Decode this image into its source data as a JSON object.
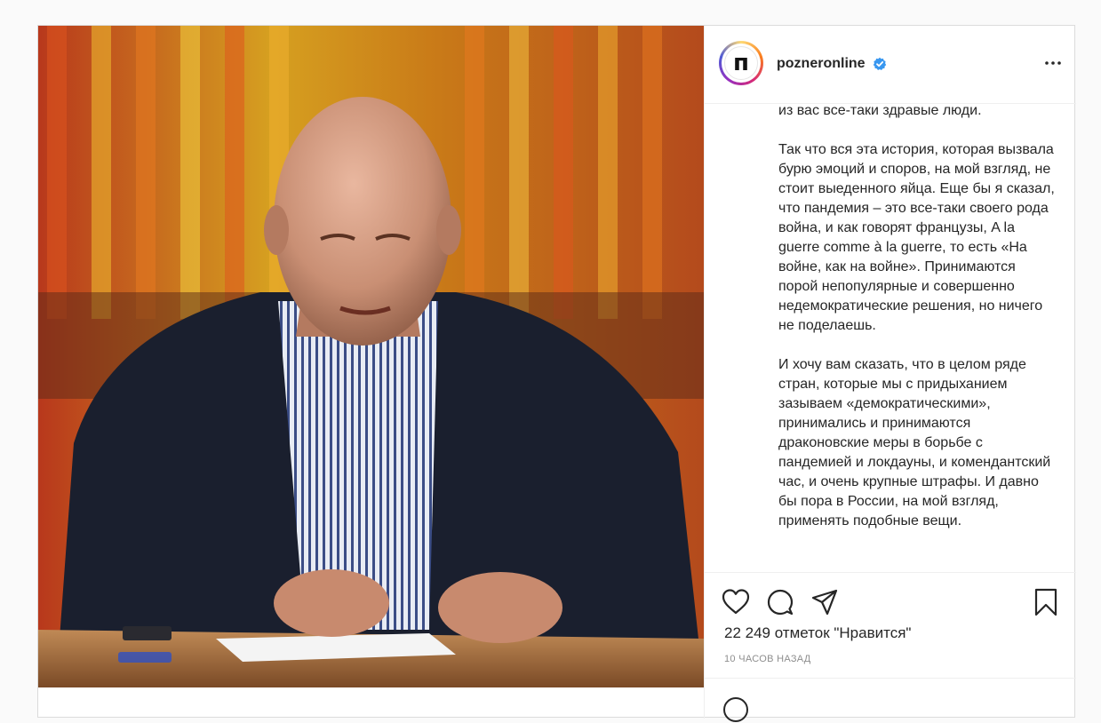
{
  "post": {
    "username": "pozneronline",
    "avatar_letter": "п",
    "caption_paragraphs": [
      "из вас все-таки здравые люди.",
      "Так что вся эта история, которая вызвала бурю эмоций и споров, на мой взгляд, не стоит выеденного яйца. Еще бы я сказал, что пандемия – это все-таки своего рода война, и как говорят французы, A la guerre comme à la guerre, то есть «На войне, как на войне». Принимаются порой непопулярные и совершенно недемократические решения, но ничего не поделаешь.",
      "И хочу вам сказать, что в целом ряде стран, которые мы с придыханием зазываем «демократическими», принимались и принимаются драконовские меры в борьбе с пандемией и локдауны, и комендантский час, и очень крупные штрафы. И давно бы пора в России, на мой взгляд, применять подобные вещи."
    ],
    "likes_text": "22 249 отметок \"Нравится\"",
    "time_text": "10 ЧАСОВ НАЗАД"
  },
  "icons": {
    "verified": "verified-badge-icon",
    "more": "more-options-icon",
    "like": "heart-icon",
    "comment": "comment-icon",
    "share": "share-icon",
    "save": "bookmark-icon",
    "emoji": "emoji-icon"
  },
  "colors": {
    "verified": "#3897f0",
    "text": "#262626",
    "muted": "#8e8e8e",
    "border": "#dbdbdb"
  }
}
